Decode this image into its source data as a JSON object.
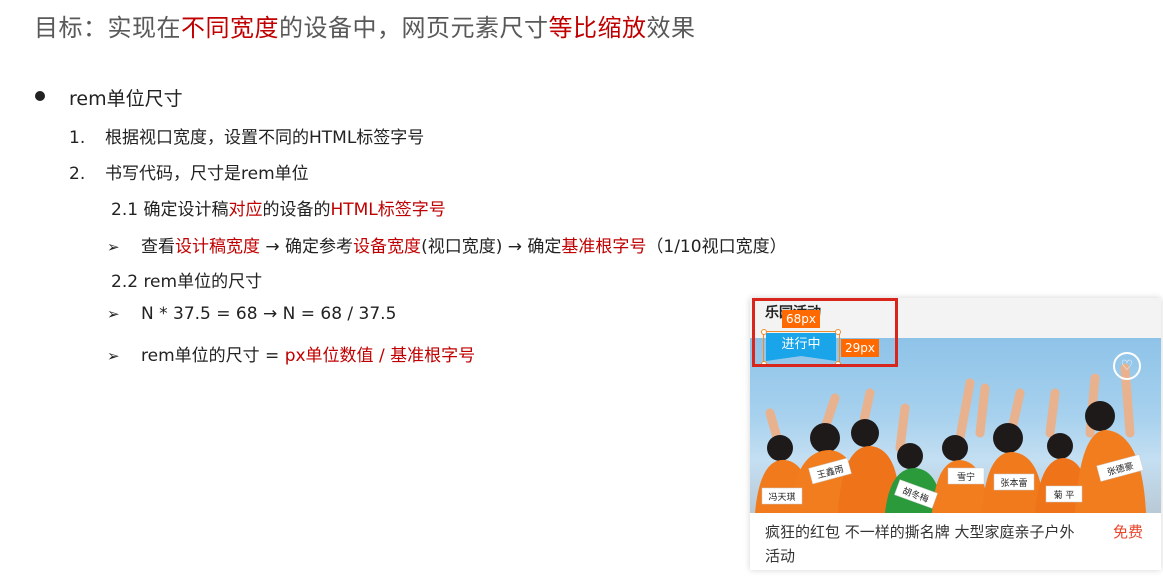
{
  "title": {
    "part1": "目标：实现在",
    "highlight1": "不同宽度",
    "part2": "的设备中，网页元素尺寸",
    "highlight2": "等比缩放",
    "part3": "效果"
  },
  "section": {
    "heading": "rem单位尺寸",
    "items": [
      {
        "num": "1.",
        "text": "根据视口宽度，设置不同的HTML标签字号"
      },
      {
        "num": "2.",
        "text": "书写代码，尺寸是rem单位"
      }
    ],
    "sub21": {
      "label": "2.1  确定设计稿",
      "red1": "对应",
      "mid": "的设备的",
      "red2": "HTML标签字号"
    },
    "arrow1": {
      "marker": "➢",
      "t1": "查看",
      "r1": "设计稿宽度",
      "t2": " → 确定参考",
      "r2": "设备宽度",
      "t3": "(视口宽度) → 确定",
      "r3": "基准根字号",
      "t4": "（1/10视口宽度）"
    },
    "sub22": "2.2  rem单位的尺寸",
    "arrow2": {
      "marker": "➢",
      "text": "N * 37.5 = 68  → N = 68 / 37.5"
    },
    "arrow3": {
      "marker": "➢",
      "t1": "rem单位的尺寸 = ",
      "r1": "px单位数值 / 基准根字号"
    }
  },
  "card": {
    "header_title": "乐园活动",
    "status_badge": "进行中",
    "width_label": "68px",
    "height_label": "29px",
    "description": "疯狂的红包 不一样的撕名牌 大型家庭亲子户外活动",
    "price": "免费",
    "heart_icon": "heart-icon",
    "name_tags": [
      "冯天琪",
      "王鑫雨",
      "胡冬梅",
      "雪宁",
      "张本雷",
      "菊 平",
      "张德豪"
    ]
  }
}
